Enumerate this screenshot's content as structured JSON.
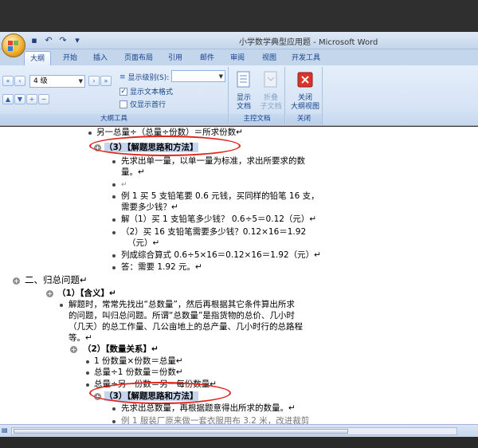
{
  "window": {
    "title": "小学数学典型应用题 - Microsoft Word"
  },
  "tabs": [
    "大纲",
    "开始",
    "插入",
    "页面布局",
    "引用",
    "邮件",
    "审阅",
    "视图",
    "开发工具"
  ],
  "ribbon": {
    "level_value": "4 级",
    "show_level_label": "显示级别(S):",
    "show_text_format": "显示文本格式",
    "show_first_line": "仅显示首行",
    "group_outline": "大纲工具",
    "show_doc": [
      "显示",
      "文档"
    ],
    "collapse_sub": [
      "折叠",
      "子文档"
    ],
    "group_master": "主控文档",
    "close_outline": [
      "关闭",
      "大纲视图"
    ],
    "group_close": "关闭"
  },
  "doc": {
    "l0": "另一总量÷（总量÷份数）＝所求份数↵",
    "h1": "（3）【解题思路和方法】",
    "l1": "先求出单一量，以单一量为标准，求出所要求的数",
    "l1b": "量。↵",
    "l2": "例 1 买 5 支铅笔要 0.6 元钱，买同样的铅笔 16 支，",
    "l2b": "需要多少钱？↵",
    "l3": "解（1）买 1 支铅笔多少钱？ 0.6÷5＝0.12（元）↵",
    "l4": "（2）买 16 支铅笔需要多少钱？0.12×16＝1.92",
    "l4b": "（元）↵",
    "l5": "列成综合算式 0.6÷5×16＝0.12×16＝1.92（元）↵",
    "l6": "答：需要 1.92 元。↵",
    "sec2": "二、归总问题↵",
    "meaning": "（1）【含义】↵",
    "p1": "解题时，常常先找出“总数量”，然后再根据其它条件算出所求",
    "p2": "的问题，叫归总问题。所谓“总数量”是指货物的总价、几小时",
    "p3": "（几天）的总工作量、几公亩地上的总产量、几小时行的总路程",
    "p4": "等。↵",
    "relation": "（2）【数量关系】↵",
    "r1": "1 份数量×份数＝总量↵",
    "r2": "总量÷1 份数量＝份数↵",
    "r3": "总量÷另一份数＝另一每份数量↵",
    "h2": "（3）【解题思路和方法】",
    "m1": "先求出总数量，再根据题意得出所求的数量。↵",
    "m2": "例 1 服装厂原来做一套衣服用布 3.2 米，改进裁剪"
  }
}
